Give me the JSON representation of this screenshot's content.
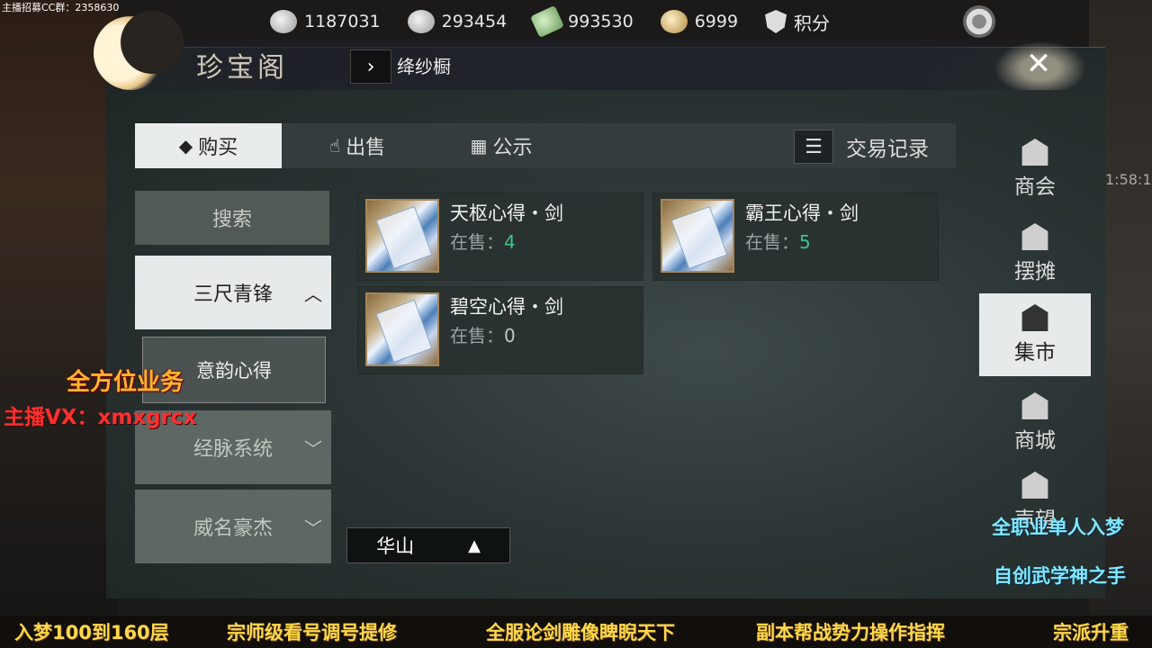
{
  "stream_tag": "主播招募CC群：2358630",
  "currencies": [
    {
      "icon": "jade-coin-icon",
      "value": "1187031"
    },
    {
      "icon": "silver-ingot-icon",
      "value": "293454"
    },
    {
      "icon": "green-jade-icon",
      "value": "993530"
    },
    {
      "icon": "gold-ingot-icon",
      "value": "6999"
    }
  ],
  "points_label": "积分",
  "window": {
    "title": "珍宝阁",
    "breadcrumb": "绛纱橱",
    "close_symbol": "✕"
  },
  "tabs": [
    {
      "label": "购买",
      "icon": "hat-icon"
    },
    {
      "label": "出售",
      "icon": "hand-icon"
    },
    {
      "label": "公示",
      "icon": "board-icon"
    }
  ],
  "history_label": "交易记录",
  "left_menu": {
    "search": "搜索",
    "open_category": "三尺青锋",
    "open_sub": "意韵心得",
    "categories": [
      "经脉系统",
      "威名豪杰"
    ]
  },
  "items": [
    {
      "name": "天枢心得・剑",
      "stock_label": "在售：",
      "stock": "4"
    },
    {
      "name": "霸王心得・剑",
      "stock_label": "在售：",
      "stock": "5"
    },
    {
      "name": "碧空心得・剑",
      "stock_label": "在售：",
      "stock": "0"
    }
  ],
  "region": "华山",
  "right_nav": [
    "商会",
    "摆摊",
    "集市",
    "商城",
    "声望"
  ],
  "right_nav_active": "集市",
  "clock": "1:58:1",
  "overlays": {
    "service": "全方位业务",
    "vx": "主播VX：xmxgrcx",
    "right1": "全职业单人入梦",
    "right2": "自创武学神之手"
  },
  "ticker": [
    "入梦100到160层",
    "宗师级看号调号提修",
    "全服论剑雕像睥睨天下",
    "副本帮战势力操作指挥",
    "宗派升重"
  ]
}
